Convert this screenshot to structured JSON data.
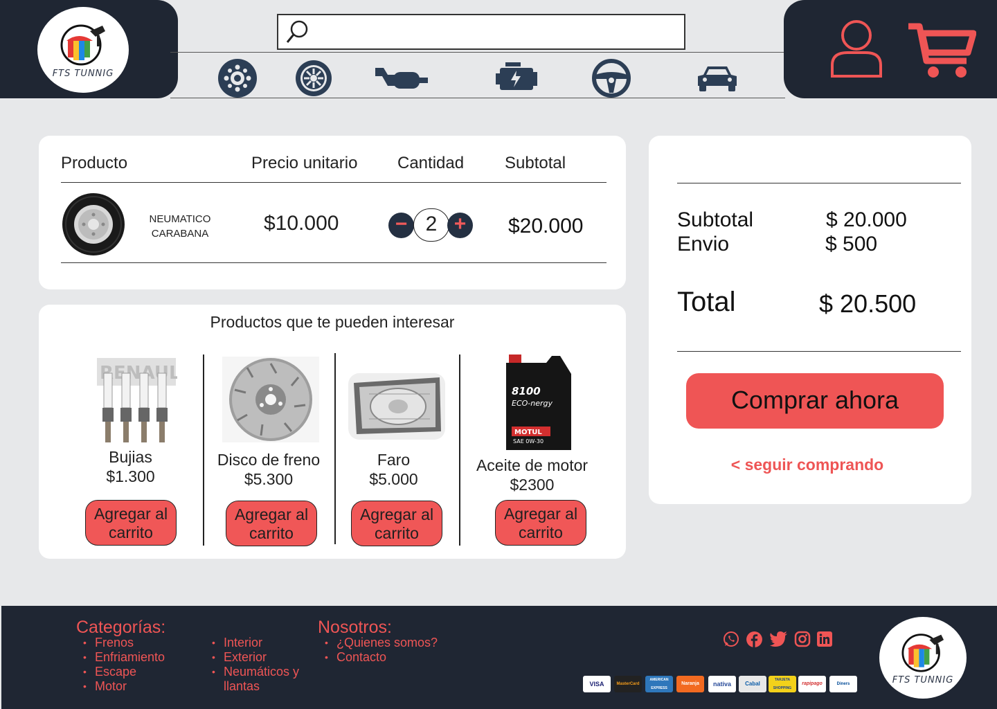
{
  "brand": {
    "name": "FTS TUNNIG"
  },
  "search": {
    "placeholder": ""
  },
  "categories_bar": [
    "brake-disc-icon",
    "wheel-icon",
    "exhaust-icon",
    "engine-icon",
    "steering-wheel-icon",
    "car-icon"
  ],
  "cart": {
    "headers": {
      "product": "Producto",
      "unit_price": "Precio unitario",
      "quantity": "Cantidad",
      "subtotal": "Subtotal"
    },
    "items": [
      {
        "name": "NEUMATICO CARABANA",
        "unit_price": "$10.000",
        "quantity": "2",
        "subtotal": "$20.000"
      }
    ],
    "minus": "−",
    "plus": "+"
  },
  "recommendations": {
    "title": "Productos que te pueden interesar",
    "items": [
      {
        "name": "Bujias",
        "price": "$1.300",
        "button": "Agregar al carrito"
      },
      {
        "name": "Disco de freno",
        "price": "$5.300",
        "button": "Agregar al carrito"
      },
      {
        "name": "Faro",
        "price": "$5.000",
        "button": "Agregar al carrito"
      },
      {
        "name": "Aceite de motor",
        "price": "$2300",
        "button": "Agregar al carrito"
      }
    ]
  },
  "summary": {
    "subtotal_label": "Subtotal",
    "subtotal_value": "$ 20.000",
    "shipping_label": "Envio",
    "shipping_value": "$ 500",
    "total_label": "Total",
    "total_value": "$ 20.500",
    "buy_button": "Comprar ahora",
    "keep_shopping": "< seguir comprando"
  },
  "footer": {
    "categories_title": "Categorías:",
    "categories_col1": [
      "Frenos",
      "Enfriamiento",
      "Escape",
      "Motor"
    ],
    "categories_col2": [
      "Interior",
      "Exterior",
      "Neumáticos y llantas"
    ],
    "about_title": "Nosotros:",
    "about_items": [
      "¿Quienes somos?",
      "Contacto"
    ],
    "social": [
      "whatsapp-icon",
      "facebook-icon",
      "twitter-icon",
      "instagram-icon",
      "linkedin-icon"
    ],
    "payment_methods": [
      "VISA",
      "MasterCard",
      "AMERICAN EXPRESS",
      "Naranja",
      "nativa",
      "Cabal",
      "TARJETA SHOPPING",
      "rapipago",
      "Diners"
    ]
  },
  "colors": {
    "dark": "#1f2633",
    "accent": "#ef5555",
    "background": "#e7e8ea"
  }
}
